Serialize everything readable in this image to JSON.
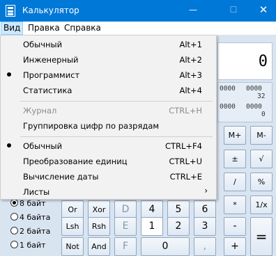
{
  "window": {
    "title": "Калькулятор",
    "min_glyph": "—",
    "max_glyph": "☐",
    "close_glyph": "✕"
  },
  "menubar": {
    "view": "Вид",
    "edit": "Правка",
    "help": "Справка"
  },
  "view_menu": {
    "mode_items": [
      {
        "label": "Обычный",
        "shortcut": "Alt+1",
        "checked": false
      },
      {
        "label": "Инженерный",
        "shortcut": "Alt+2",
        "checked": false
      },
      {
        "label": "Программист",
        "shortcut": "Alt+3",
        "checked": true
      },
      {
        "label": "Статистика",
        "shortcut": "Alt+4",
        "checked": false
      }
    ],
    "history": {
      "label": "Журнал",
      "shortcut": "CTRL+H",
      "disabled": true
    },
    "digit_grouping": {
      "label": "Группировка цифр по разрядам"
    },
    "extra_items": [
      {
        "label": "Обычный",
        "shortcut": "CTRL+F4",
        "checked": true,
        "highlighted": true
      },
      {
        "label": "Преобразование единиц",
        "shortcut": "CTRL+U",
        "checked": false
      },
      {
        "label": "Вычисление даты",
        "shortcut": "CTRL+E",
        "checked": false
      }
    ],
    "worksheets": {
      "label": "Листы",
      "arrow": "›"
    }
  },
  "display": {
    "value": "0"
  },
  "bit_panel": {
    "row1_a": "0000",
    "row1_b": "0000",
    "row1_num": "32",
    "row2_a": "0000",
    "row2_b": "0000",
    "row2_num": "0"
  },
  "word_size": [
    {
      "label": "8 байт",
      "selected": true
    },
    {
      "label": "4 байта",
      "selected": false
    },
    {
      "label": "2 байта",
      "selected": false
    },
    {
      "label": "1 байт",
      "selected": false
    }
  ],
  "keys": {
    "mplus": "M+",
    "mminus": "M-",
    "plusminus": "±",
    "sqrt": "√",
    "divide": "/",
    "percent": "%",
    "or": "Or",
    "xor": "Xor",
    "d": "D",
    "four": "4",
    "five": "5",
    "six": "6",
    "multiply": "*",
    "reciprocal": "1/x",
    "lsh": "Lsh",
    "rsh": "Rsh",
    "e": "E",
    "one": "1",
    "two": "2",
    "three": "3",
    "minus": "-",
    "equals": "=",
    "not": "Not",
    "and": "And",
    "f": "F",
    "zero": "0",
    "comma": ",",
    "plus": "+"
  }
}
